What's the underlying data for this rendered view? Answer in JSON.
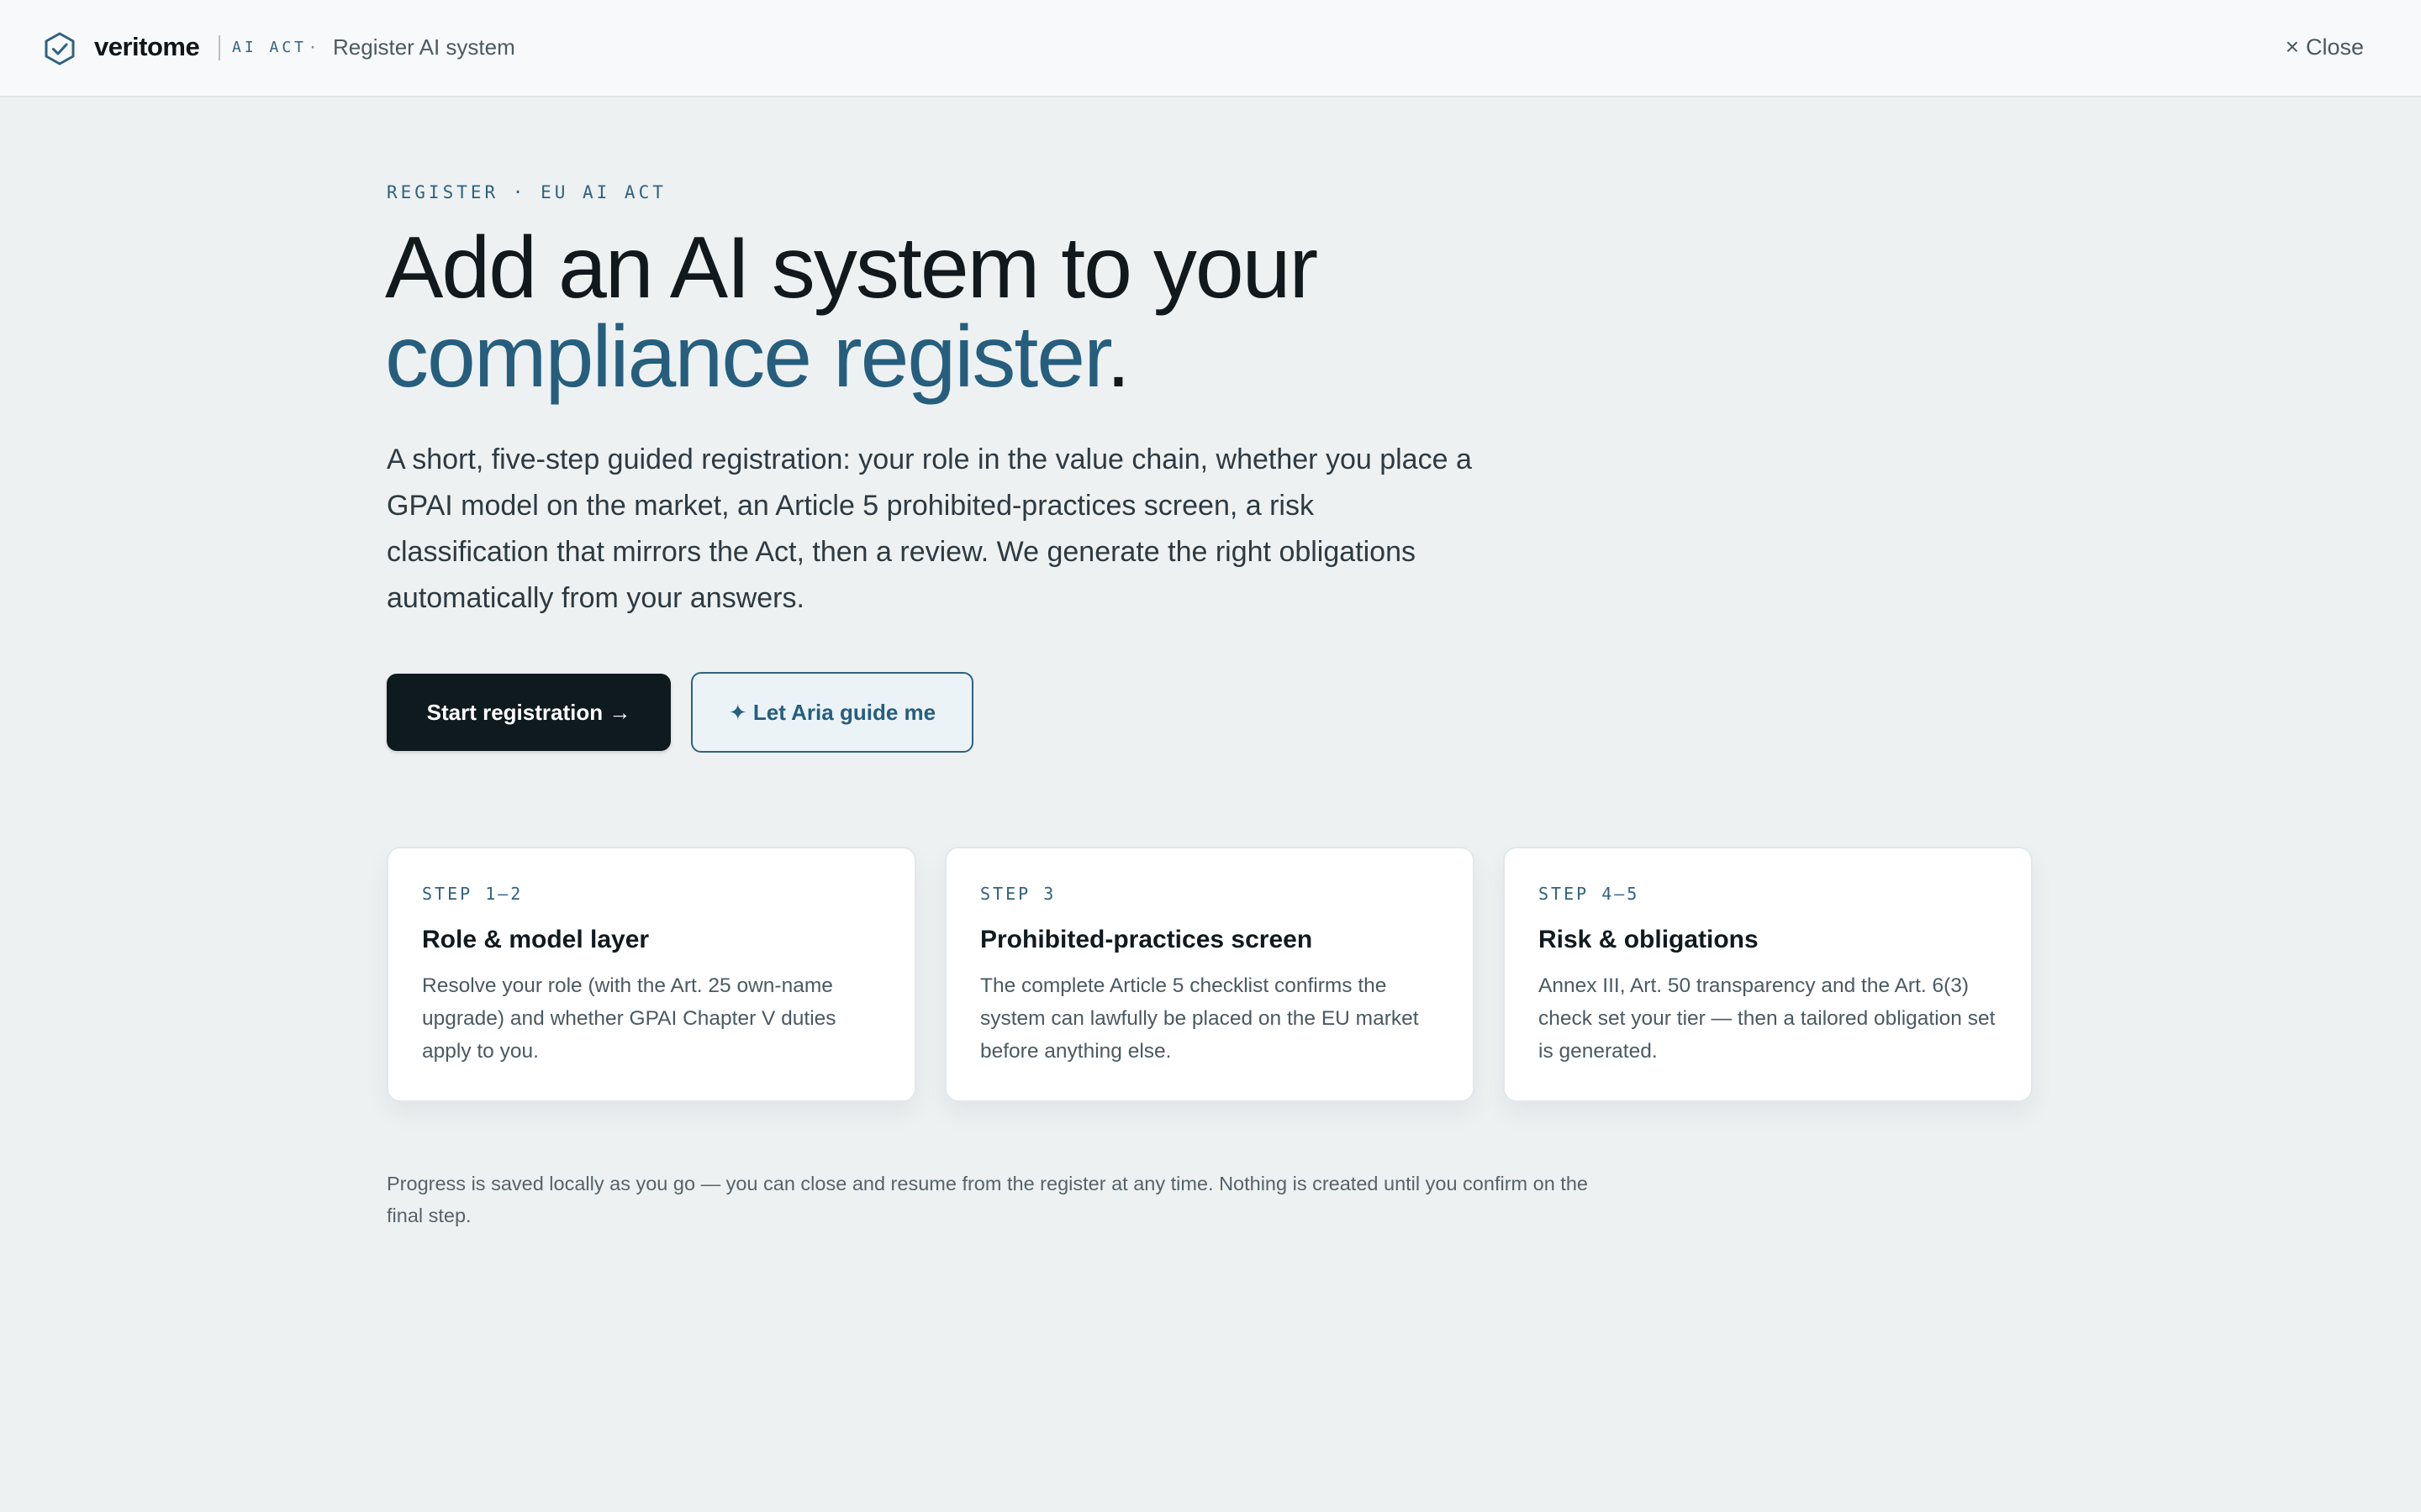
{
  "app": {
    "brand": "veritome",
    "product_tag": "AI ACT",
    "crumb_separator": "·",
    "page_title": "Register AI system",
    "close_label": "Close",
    "close_icon": "×"
  },
  "hero": {
    "eyebrow": "REGISTER · EU AI ACT",
    "headline_line1": "Add an AI system to your",
    "headline_accent": "compliance register",
    "headline_end": ".",
    "lede": "A short, five-step guided registration: your role in the value chain, whether you place a GPAI model on the market, an Article 5 prohibited-practices screen, a risk classification that mirrors the Act, then a review. We generate the right obligations automatically from your answers.",
    "primary_button": "Start registration →",
    "secondary_button": "✦ Let Aria guide me"
  },
  "steps": [
    {
      "step": "STEP 1–2",
      "title": "Role & model layer",
      "description": "Resolve your role (with the Art. 25 own-name upgrade) and whether GPAI Chapter V duties apply to you."
    },
    {
      "step": "STEP 3",
      "title": "Prohibited-practices screen",
      "description": "The complete Article 5 checklist confirms the system can lawfully be placed on the EU market before anything else."
    },
    {
      "step": "STEP 4–5",
      "title": "Risk & obligations",
      "description": "Annex III, Art. 50 transparency and the Art. 6(3) check set your tier — then a tailored obligation set is generated."
    }
  ],
  "footnote": "Progress is saved locally as you go — you can close and resume from the register at any time. Nothing is created until you confirm on the final step.",
  "colors": {
    "accent": "#265e7e",
    "primary_button": "#0f1a1f",
    "background": "#eef1f2"
  },
  "icons": {
    "brand": "shield-check-icon"
  }
}
